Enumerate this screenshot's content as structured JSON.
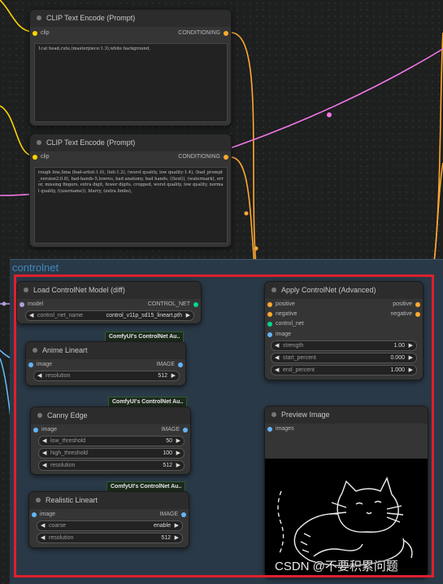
{
  "colors": {
    "conditioning": "#ffa931",
    "clip": "#ffd500",
    "image": "#64b5f6",
    "control_net": "#00d78d",
    "model": "#b39ddb",
    "pink_wire": "#f078e6",
    "group_title": "#3f87b9",
    "selection": "#e01f2c"
  },
  "clip_pos": {
    "title": "CLIP Text Encode (Prompt)",
    "input_clip": "clip",
    "output": "CONDITIONING",
    "text": "1cat head,cute,(masterpiece:1.3),white background,"
  },
  "clip_neg": {
    "title": "CLIP Text Encode (Prompt)",
    "input_clip": "clip",
    "output": "CONDITIONING",
    "text": "rough line,lima (bad-artist:1.0), (loli:1.2), (worst quality, low quality:1.4), (bad_prompt_version2:0.8), bad-hands-5,lowres, bad anatomy, bad hands, ((text)), (watermark), error, missing fingers, extra digit, fewer digits, cropped, worst quality, low quality, normal quality, ((username)), blurry, (extra limbs),"
  },
  "group": {
    "title": "controlnet"
  },
  "load_cn": {
    "title": "Load ControlNet Model (diff)",
    "input_model": "model",
    "output": "CONTROL_NET",
    "widget_name": "control_net_name",
    "widget_value": "control_v11p_sd15_lineart.pth"
  },
  "apply_cn": {
    "title": "Apply ControlNet (Advanced)",
    "in_positive": "positive",
    "in_negative": "negative",
    "in_control_net": "control_net",
    "in_image": "image",
    "out_positive": "positive",
    "out_negative": "negative",
    "strength_label": "strength",
    "strength_value": "1.00",
    "start_label": "start_percent",
    "start_value": "0.000",
    "end_label": "end_percent",
    "end_value": "1.000"
  },
  "anime": {
    "badge": "ComfyUI's ControlNet Au..",
    "title": "Anime Lineart",
    "in_image": "image",
    "out_image": "IMAGE",
    "res_label": "resolution",
    "res_value": "512"
  },
  "canny": {
    "badge": "ComfyUI's ControlNet Au..",
    "title": "Canny Edge",
    "in_image": "image",
    "out_image": "IMAGE",
    "low_label": "low_threshold",
    "low_value": "50",
    "high_label": "high_threshold",
    "high_value": "100",
    "res_label": "resolution",
    "res_value": "512"
  },
  "realistic": {
    "badge": "ComfyUI's ControlNet Au..",
    "title": "Realistic Lineart",
    "in_image": "image",
    "out_image": "IMAGE",
    "coarse_label": "coarse",
    "coarse_value": "enable",
    "res_label": "resolution",
    "res_value": "512"
  },
  "preview": {
    "title": "Preview Image",
    "in_images": "images"
  },
  "watermark": "CSDN @不要积累问题"
}
